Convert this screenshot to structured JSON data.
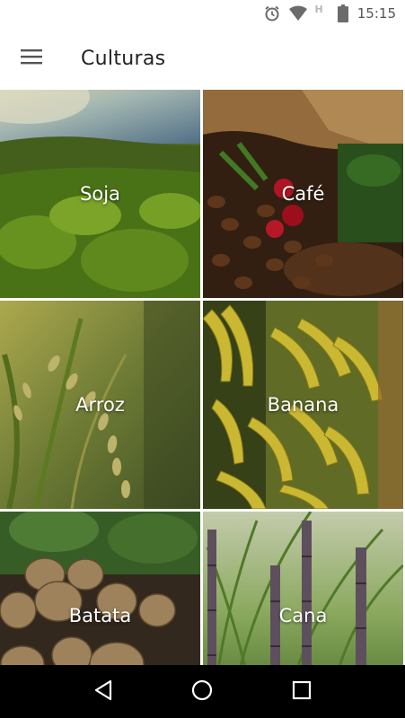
{
  "status_bar": {
    "time": "15:15",
    "network_letter": "H",
    "icons": [
      "alarm-icon",
      "wifi-icon",
      "battery-icon"
    ]
  },
  "app_bar": {
    "title": "Culturas",
    "menu_icon": "hamburger-menu-icon"
  },
  "crops": [
    {
      "label": "Soja",
      "image": "soybean-field-photo"
    },
    {
      "label": "Café",
      "image": "coffee-beans-photo"
    },
    {
      "label": "Arroz",
      "image": "rice-stalks-photo"
    },
    {
      "label": "Banana",
      "image": "banana-bunches-photo"
    },
    {
      "label": "Batata",
      "image": "potatoes-photo"
    },
    {
      "label": "Cana",
      "image": "sugarcane-photo"
    }
  ],
  "nav_bar": {
    "icons": [
      "back-icon",
      "home-icon",
      "recents-icon"
    ]
  },
  "colors": {
    "background": "#ffffff",
    "title_text": "#222222",
    "tile_label": "#ffffff",
    "nav_bar": "#000000"
  }
}
